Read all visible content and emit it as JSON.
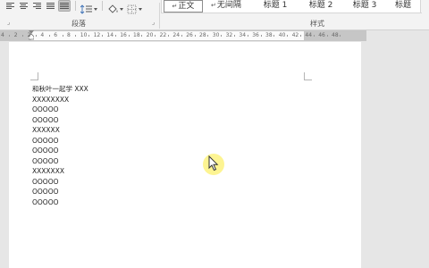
{
  "ribbon": {
    "paragraph_group_label": "段落",
    "styles_group_label": "样式",
    "styles": [
      {
        "label": "正文",
        "selected": true
      },
      {
        "label": "无间隔",
        "selected": false
      },
      {
        "label": "标题 1",
        "selected": false
      },
      {
        "label": "标题 2",
        "selected": false
      },
      {
        "label": "标题 3",
        "selected": false
      },
      {
        "label": "标题",
        "selected": false
      }
    ]
  },
  "ruler": {
    "numbers": [
      "4",
      "2",
      "2",
      "4",
      "6",
      "8",
      "10",
      "12",
      "14",
      "16",
      "18",
      "20",
      "22",
      "24",
      "26",
      "28",
      "30",
      "32",
      "34",
      "36",
      "38",
      "40",
      "42",
      "44",
      "46",
      "48"
    ]
  },
  "document": {
    "lines": [
      "和秋叶一起学 XXX",
      "XXXXXXXX",
      "OOOOO",
      "OOOOO",
      "XXXXXX",
      "OOOOO",
      "OOOOO",
      "OOOOO",
      "XXXXXXX",
      "OOOOO",
      "OOOOO",
      "OOOOO"
    ]
  },
  "colors": {
    "ribbon_bg": "#f3f3f3",
    "workspace_bg": "#e6e6e6",
    "page_bg": "#ffffff",
    "cursor_highlight": "#fcf06e"
  }
}
